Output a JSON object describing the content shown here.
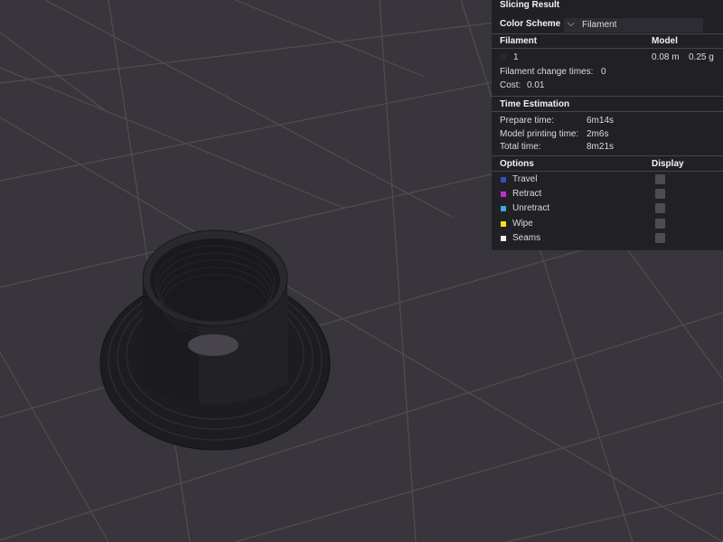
{
  "panel": {
    "title": "Slicing Result",
    "color_scheme": {
      "label": "Color Scheme",
      "selected": "Filament",
      "chevron_icon": "chevron-down-icon"
    },
    "filament_table": {
      "col_filament": "Filament",
      "col_model": "Model",
      "rows": [
        {
          "index": "1",
          "length": "0.08 m",
          "weight": "0.25 g",
          "color": "#2a2a2a"
        }
      ]
    },
    "filament_change": {
      "label": "Filament change times:",
      "value": "0"
    },
    "cost": {
      "label": "Cost:",
      "value": "0.01"
    },
    "time_estimation": {
      "title": "Time Estimation",
      "prepare": {
        "label": "Prepare time:",
        "value": "6m14s"
      },
      "model_printing": {
        "label": "Model printing time:",
        "value": "2m6s"
      },
      "total": {
        "label": "Total time:",
        "value": "8m21s"
      }
    },
    "options": {
      "col_options": "Options",
      "col_display": "Display",
      "items": [
        {
          "label": "Travel",
          "color": "#3a4fbf",
          "display": false
        },
        {
          "label": "Retract",
          "color": "#c12fc9",
          "display": false
        },
        {
          "label": "Unretract",
          "color": "#3fa9d9",
          "display": false
        },
        {
          "label": "Wipe",
          "color": "#f2e61a",
          "display": false
        },
        {
          "label": "Seams",
          "color": "#f0f0f0",
          "display": false
        }
      ]
    }
  },
  "viewport": {
    "background": "#38363c",
    "grid_color": "#55535a",
    "model_color": "#1e1e20"
  }
}
